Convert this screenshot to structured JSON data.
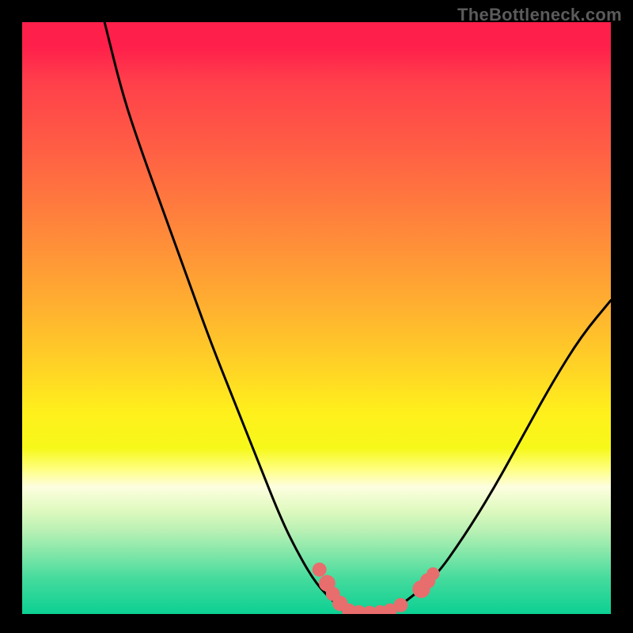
{
  "attribution": "TheBottleneck.com",
  "gradient_colors": {
    "top": "#ff1f4b",
    "mid_upper": "#ff8a3a",
    "mid": "#fff01c",
    "lower_mid": "#ffff7f",
    "bottom": "#0bd092"
  },
  "chart_data": {
    "type": "line",
    "title": "",
    "xlabel": "",
    "ylabel": "",
    "xlim": [
      0,
      100
    ],
    "ylim": [
      0,
      100
    ],
    "series": [
      {
        "name": "bottleneck-curve",
        "x": [
          14,
          17,
          20,
          24,
          28,
          32,
          36,
          40,
          44,
          47,
          50,
          53,
          55,
          57,
          62,
          65,
          70,
          75,
          80,
          85,
          90,
          95,
          100
        ],
        "y": [
          100,
          88,
          79,
          68,
          57,
          46,
          36,
          26,
          16,
          10,
          5,
          2,
          0,
          0,
          0,
          2,
          6,
          13,
          21,
          30,
          39,
          47,
          53
        ]
      }
    ],
    "markers": [
      {
        "name": "marker-left-1",
        "x": 50.5,
        "y": 7.5,
        "r": 1.2
      },
      {
        "name": "marker-left-2",
        "x": 51.8,
        "y": 5.2,
        "r": 1.4
      },
      {
        "name": "marker-left-3",
        "x": 52.8,
        "y": 3.4,
        "r": 1.2
      },
      {
        "name": "marker-left-4",
        "x": 54.0,
        "y": 1.8,
        "r": 1.3
      },
      {
        "name": "marker-floor-1",
        "x": 55.5,
        "y": 0.6,
        "r": 1.2
      },
      {
        "name": "marker-floor-2",
        "x": 57.2,
        "y": 0.3,
        "r": 1.2
      },
      {
        "name": "marker-floor-3",
        "x": 59.0,
        "y": 0.2,
        "r": 1.2
      },
      {
        "name": "marker-floor-4",
        "x": 60.8,
        "y": 0.3,
        "r": 1.2
      },
      {
        "name": "marker-floor-5",
        "x": 62.5,
        "y": 0.6,
        "r": 1.2
      },
      {
        "name": "marker-right-1",
        "x": 64.3,
        "y": 1.5,
        "r": 1.2
      },
      {
        "name": "marker-right-2",
        "x": 67.8,
        "y": 4.2,
        "r": 1.5
      },
      {
        "name": "marker-right-3",
        "x": 68.9,
        "y": 5.6,
        "r": 1.3
      },
      {
        "name": "marker-right-4",
        "x": 69.8,
        "y": 6.8,
        "r": 1.1
      }
    ],
    "marker_color": "#e86d6d",
    "curve_color": "#000000"
  }
}
